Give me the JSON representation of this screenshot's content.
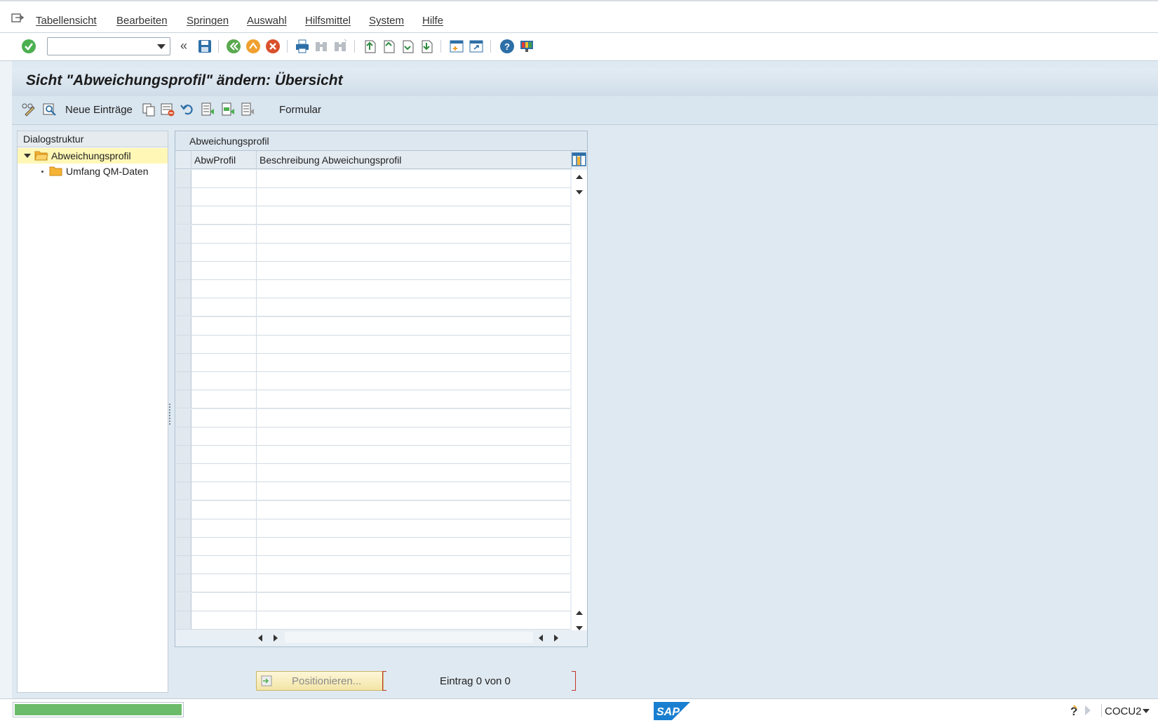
{
  "menubar": {
    "items": [
      "Tabellensicht",
      "Bearbeiten",
      "Springen",
      "Auswahl",
      "Hilfsmittel",
      "System",
      "Hilfe"
    ]
  },
  "toolbar": {
    "command_field_value": "",
    "back_label": "«"
  },
  "screen": {
    "title": "Sicht \"Abweichungsprofil\" ändern: Übersicht"
  },
  "app_toolbar": {
    "new_entries": "Neue Einträge",
    "form": "Formular"
  },
  "dialog_structure": {
    "header": "Dialogstruktur",
    "items": [
      {
        "label": "Abweichungsprofil",
        "selected": true,
        "expanded": true
      },
      {
        "label": "Umfang QM-Daten",
        "selected": false,
        "expanded": false
      }
    ]
  },
  "table": {
    "title": "Abweichungsprofil",
    "columns": [
      "AbwProfil",
      "Beschreibung Abweichungsprofil"
    ],
    "visible_empty_rows": 25,
    "rows": []
  },
  "footer": {
    "position_button": "Positionieren...",
    "entry_info": "Eintrag 0 von 0"
  },
  "statusbar": {
    "system": "COCU2",
    "logo": "SAP"
  },
  "colors": {
    "accent": "#0a6ed1",
    "selected_row": "#fff7b6",
    "progress": "#6cbb6a"
  }
}
